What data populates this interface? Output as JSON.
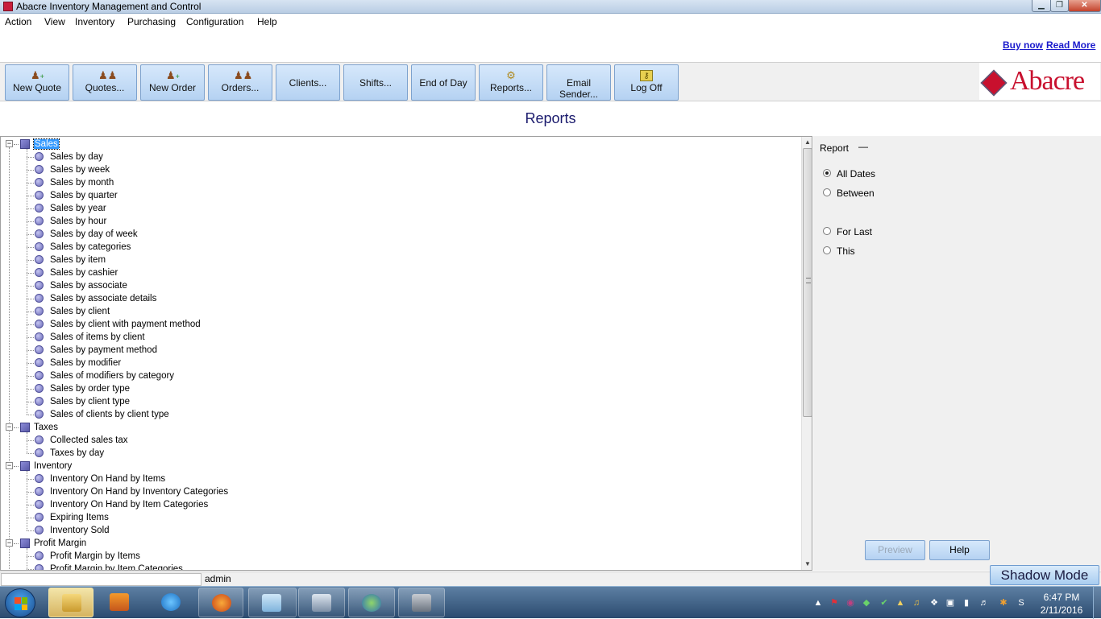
{
  "window": {
    "title": "Abacre Inventory Management and Control",
    "controls": {
      "minimize": "▁",
      "maximize": "❐",
      "close": "✕"
    }
  },
  "menu": [
    "Action",
    "View",
    "Inventory",
    "Purchasing",
    "Configuration",
    "Help"
  ],
  "promo": {
    "buy_now": "Buy now",
    "read_more": "Read More"
  },
  "toolbar": {
    "buttons": [
      {
        "label": "New Quote",
        "icon": "new-quote-icon"
      },
      {
        "label": "Quotes...",
        "icon": "quotes-icon"
      },
      {
        "label": "New Order",
        "icon": "new-order-icon"
      },
      {
        "label": "Orders...",
        "icon": "orders-icon"
      },
      {
        "label": "Clients...",
        "icon": ""
      },
      {
        "label": "Shifts...",
        "icon": ""
      },
      {
        "label": "End of Day",
        "icon": ""
      },
      {
        "label": "Reports...",
        "icon": "reports-icon"
      },
      {
        "label": "Email Sender...",
        "icon": ""
      },
      {
        "label": "Log Off",
        "icon": "key-icon"
      }
    ],
    "logo_text": "Abacre"
  },
  "page_title": "Reports",
  "tree": {
    "groups": [
      {
        "label": "Sales",
        "selected": true,
        "items": [
          "Sales by day",
          "Sales by week",
          "Sales by month",
          "Sales by quarter",
          "Sales by year",
          "Sales by hour",
          "Sales by day of week",
          "Sales by categories",
          "Sales by item",
          "Sales by cashier",
          "Sales by associate",
          "Sales by associate details",
          "Sales by client",
          "Sales by client with payment method",
          "Sales of items by client",
          "Sales by payment method",
          "Sales by modifier",
          "Sales of modifiers by category",
          "Sales by order type",
          "Sales by client type",
          "Sales of clients by client type"
        ]
      },
      {
        "label": "Taxes",
        "selected": false,
        "items": [
          "Collected sales tax",
          "Taxes by day"
        ]
      },
      {
        "label": "Inventory",
        "selected": false,
        "items": [
          "Inventory On Hand by Items",
          "Inventory On Hand by Inventory Categories",
          "Inventory On Hand by Item Categories",
          "Expiring Items",
          "Inventory Sold"
        ]
      },
      {
        "label": "Profit Margin",
        "selected": false,
        "items": [
          "Profit Margin by Items",
          "Profit Margin by Item Categories"
        ]
      }
    ]
  },
  "right_panel": {
    "report_label": "Report",
    "report_value": "—",
    "options": [
      {
        "label": "All Dates",
        "checked": true
      },
      {
        "label": "Between",
        "checked": false
      },
      {
        "label": "For Last",
        "checked": false
      },
      {
        "label": "This",
        "checked": false
      }
    ],
    "preview_label": "Preview",
    "help_label": "Help"
  },
  "status": {
    "cell1": "",
    "user": "admin",
    "shadow_mode": "Shadow Mode"
  },
  "taskbar": {
    "time": "6:47 PM",
    "date": "2/11/2016",
    "apps": [
      "windows-explorer-icon",
      "media-player-icon",
      "internet-explorer-icon",
      "firefox-icon",
      "notepad-icon",
      "display-app-icon",
      "globe-app-icon",
      "terminal-app-icon"
    ],
    "tray_icons": [
      "show-hidden-icons-icon",
      "flag-icon",
      "antivirus-icon",
      "network-app-icon",
      "check-icon",
      "signal-icon",
      "music-icon",
      "bluetooth-icon",
      "monitor-icon",
      "device-icon",
      "volume-icon",
      "notification-icon",
      "power-icon",
      "skype-icon"
    ]
  }
}
